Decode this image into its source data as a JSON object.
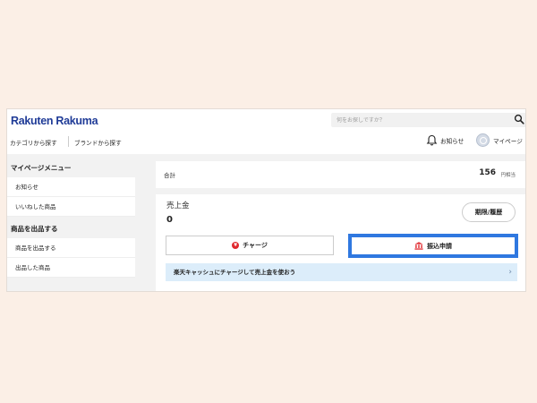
{
  "header": {
    "logo": "Rakuten Rakuma",
    "search_placeholder": "何をお探しですか？",
    "nav": {
      "category": "カテゴリから探す",
      "brand": "ブランドから探す"
    },
    "notifications_label": "お知らせ",
    "mypage_label": "マイページ"
  },
  "sidebar": {
    "menu_heading": "マイページメニュー",
    "menu_items": [
      "お知らせ",
      "いいねした商品"
    ],
    "sell_heading": "商品を出品する",
    "sell_items": [
      "商品を出品する",
      "出品した商品"
    ]
  },
  "total": {
    "label": "合計",
    "amount": "156",
    "unit": "円相当"
  },
  "sales": {
    "label": "売上金",
    "value": "0",
    "history_button": "期限/履歴",
    "charge_button": "チャージ",
    "transfer_button": "振込申請",
    "promo": "楽天キャッシュにチャージして売上金を使おう"
  },
  "colors": {
    "brand": "#1f3b97",
    "accent_red": "#e0282d",
    "highlight_blue": "#2f78e0",
    "banner_bg": "#dcedfa"
  }
}
